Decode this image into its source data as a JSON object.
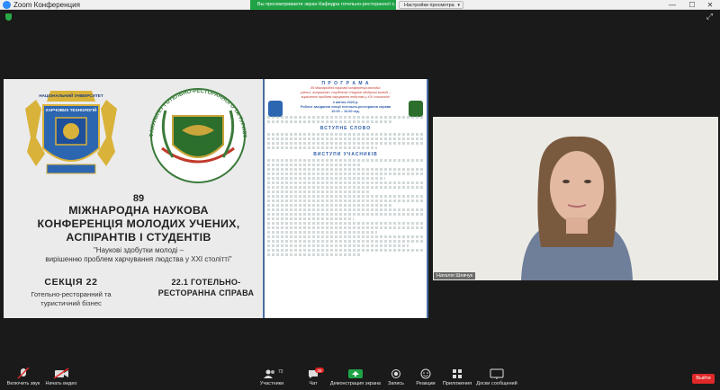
{
  "window": {
    "title": "Zoom Конференция",
    "controls": [
      "—",
      "☐",
      "✕"
    ]
  },
  "share": {
    "banner": "Вы просматриваете экран Кафедра готельно-ресторанної с...",
    "view_options": "Настройки просмотра"
  },
  "slide": {
    "number": "89",
    "title_lines": [
      "МІЖНАРОДНА НАУКОВА",
      "КОНФЕРЕНЦІЯ МОЛОДИХ УЧЕНИХ,",
      "АСПІРАНТІВ І СТУДЕНТІВ"
    ],
    "theme_lines": [
      "\"Наукові здобутки молоді –",
      "вирішенню проблем харчування людства у XXI столітті\""
    ],
    "section_heading": "СЕКЦІЯ 22",
    "section_lines": [
      "Готельно-ресторанний та",
      "туристичний бізнес"
    ],
    "subsection_lines": [
      "22.1 ГОТЕЛЬНО-",
      "РЕСТОРАННА СПРАВА"
    ],
    "emblem1_lines": [
      "НАЦІОНАЛЬНИЙ УНІВЕРСИТЕТ",
      "ХАРЧОВИХ ТЕХНОЛОГІЙ"
    ],
    "emblem2_text": "ФАКУЛЬТЕТ ГОТЕЛЬНО-РЕСТОРАННОГО ТА ТУРИСТИЧНОГО БІЗНЕСУ"
  },
  "program": {
    "heading": "П Р О Г Р А М А",
    "subtitle_lines": [
      "89 Міжнародної наукової конференції молодих",
      "учених, аспірантів і студентів «Наукові здобутки молоді –",
      "вирішенню проблем харчування людства у XXI столітті»"
    ],
    "date_lines": [
      "4 квітня 2023 р.",
      "Робоче засідання секції готельно-ресторанна справа",
      "10.00 – 13.00 год."
    ],
    "intro_heading": "ВСТУПНЕ СЛОВО",
    "speakers_heading": "ВИСТУПИ УЧАСНИКІВ"
  },
  "video": {
    "participant_name": "Наталія Шевчук"
  },
  "toolbar": {
    "items": [
      {
        "label": "Включить звук",
        "icon": "mic-muted-icon"
      },
      {
        "label": "Начать видео",
        "icon": "video-off-icon"
      },
      {
        "label": "Участники",
        "icon": "participants-icon",
        "count": "72"
      },
      {
        "label": "Чат",
        "icon": "chat-icon",
        "badge": "26"
      },
      {
        "label": "Демонстрация экрана",
        "icon": "share-screen-icon"
      },
      {
        "label": "Запись",
        "icon": "record-icon"
      },
      {
        "label": "Реакции",
        "icon": "reactions-icon"
      },
      {
        "label": "Приложения",
        "icon": "apps-icon"
      },
      {
        "label": "Доски сообщений",
        "icon": "whiteboard-icon"
      }
    ],
    "end_label": "Выйти"
  },
  "colors": {
    "share_green": "#1fa346",
    "end_red": "#e02828",
    "program_blue": "#2e5da8"
  }
}
